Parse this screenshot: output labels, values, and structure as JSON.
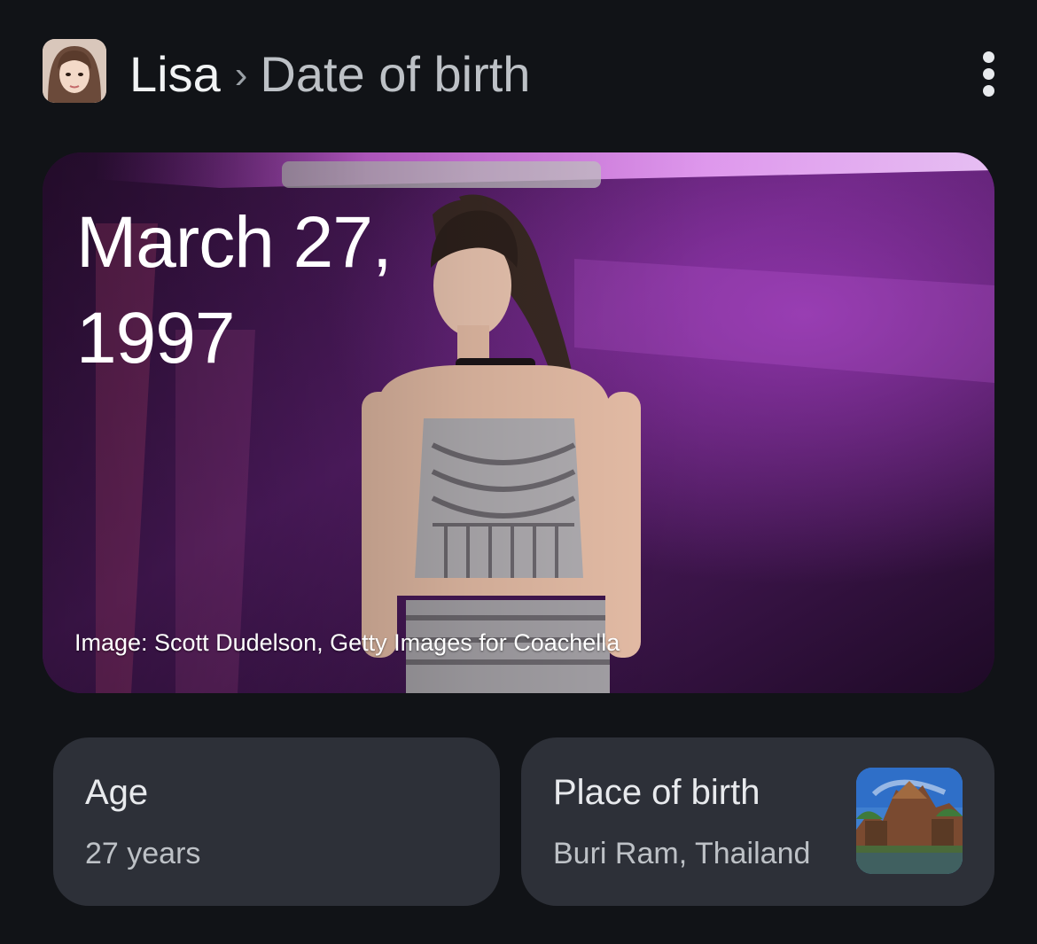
{
  "header": {
    "entity_name": "Lisa",
    "separator": "›",
    "topic": "Date of birth",
    "avatar_icon": "person-avatar-icon",
    "more_icon": "more-vert-icon"
  },
  "hero": {
    "date_line1": "March 27,",
    "date_line2": "1997",
    "credit": "Image: Scott Dudelson, Getty Images for Coachella"
  },
  "cards": {
    "age": {
      "title": "Age",
      "value": "27 years"
    },
    "place": {
      "title": "Place of birth",
      "value": "Buri Ram, Thailand",
      "thumb_icon": "temple-landscape-thumbnail"
    }
  },
  "colors": {
    "background": "#111317",
    "card": "#2d3038",
    "hero_accent": "#b02cc8"
  }
}
